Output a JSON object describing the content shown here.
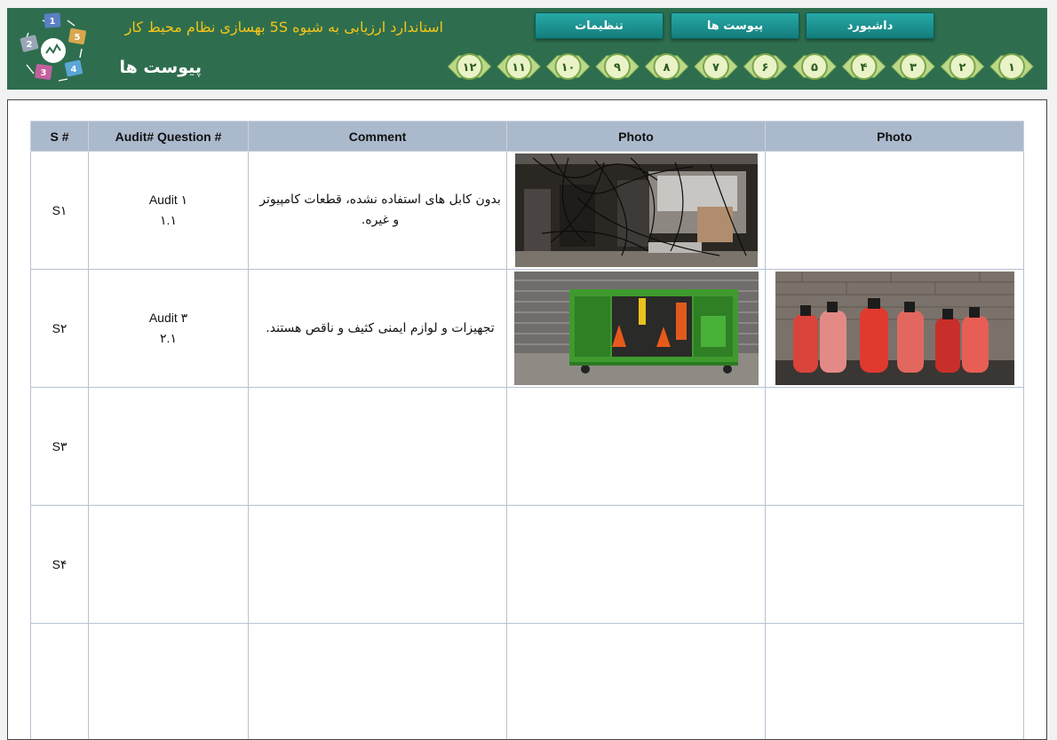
{
  "header": {
    "app_title": "استاندارد ارزیابی به شیوه 5S بهسازی نظام محیط کار",
    "page_title": "پیوست ها",
    "nav": [
      {
        "label": "داشبورد"
      },
      {
        "label": "پیوست ها"
      },
      {
        "label": "تنظیمات"
      }
    ],
    "steps": [
      "۱",
      "۲",
      "۳",
      "۴",
      "۵",
      "۶",
      "۷",
      "۸",
      "۹",
      "۱۰",
      "۱۱",
      "۱۲"
    ],
    "logo_numbers": [
      "1",
      "2",
      "3",
      "4",
      "5"
    ]
  },
  "colors": {
    "header_bg": "#2e6e4e",
    "title_yellow": "#f5c518",
    "button_teal": "#1a9896",
    "table_header_bg": "#abb9cc",
    "step_circle": "#e9f3c7"
  },
  "table": {
    "headers": [
      "S #",
      "Audit# Question #",
      "Comment",
      "Photo",
      "Photo"
    ],
    "rows": [
      {
        "s": "S۱",
        "audit": "Audit ۱",
        "question": "۱.۱",
        "comment": "بدون کابل های استفاده نشده، قطعات کامپیوتر و غیره.",
        "photo1": "cables-photo",
        "photo2": ""
      },
      {
        "s": "S۲",
        "audit": "Audit ۳",
        "question": "۲.۱",
        "comment": "تجهیزات و لوازم ایمنی کثیف و ناقص هستند.",
        "photo1": "safety-cabinet-photo",
        "photo2": "fire-extinguishers-photo"
      },
      {
        "s": "S۳",
        "audit": "",
        "question": "",
        "comment": "",
        "photo1": "",
        "photo2": ""
      },
      {
        "s": "S۴",
        "audit": "",
        "question": "",
        "comment": "",
        "photo1": "",
        "photo2": ""
      },
      {
        "s": "",
        "audit": "",
        "question": "",
        "comment": "",
        "photo1": "",
        "photo2": ""
      }
    ]
  }
}
